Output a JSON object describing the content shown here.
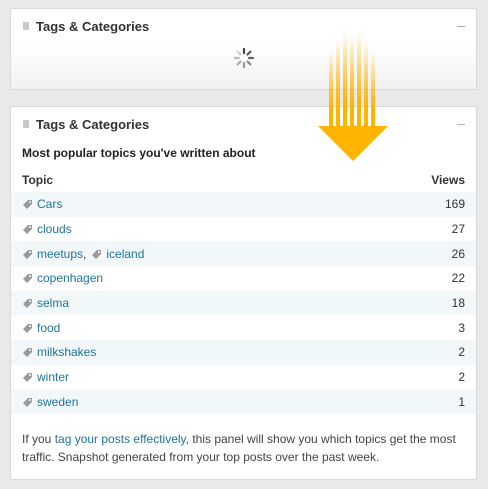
{
  "loading_panel": {
    "title": "Tags & Categories",
    "collapse_label": "–"
  },
  "main_panel": {
    "title": "Tags & Categories",
    "collapse_label": "–",
    "subtitle": "Most popular topics you've written about",
    "columns": {
      "topic": "Topic",
      "views": "Views"
    },
    "rows": [
      {
        "topics": [
          "Cars"
        ],
        "views": "169"
      },
      {
        "topics": [
          "clouds"
        ],
        "views": "27"
      },
      {
        "topics": [
          "meetups",
          "iceland"
        ],
        "views": "26"
      },
      {
        "topics": [
          "copenhagen"
        ],
        "views": "22"
      },
      {
        "topics": [
          "selma"
        ],
        "views": "18"
      },
      {
        "topics": [
          "food"
        ],
        "views": "3"
      },
      {
        "topics": [
          "milkshakes"
        ],
        "views": "2"
      },
      {
        "topics": [
          "winter"
        ],
        "views": "2"
      },
      {
        "topics": [
          "sweden"
        ],
        "views": "1"
      }
    ],
    "separator": ",",
    "footer": {
      "prefix": "If you ",
      "link": "tag your posts effectively",
      "suffix": ", this panel will show you which topics get the most traffic. Snapshot generated from your top posts over the past week."
    }
  },
  "colors": {
    "link": "#21759b",
    "row_alt": "#f2f7fa",
    "arrow": "#ffb400"
  },
  "icons": {
    "grip": "grip-icon",
    "tag": "tag-icon",
    "spinner": "loading-spinner-icon",
    "arrow": "down-arrow-icon"
  }
}
